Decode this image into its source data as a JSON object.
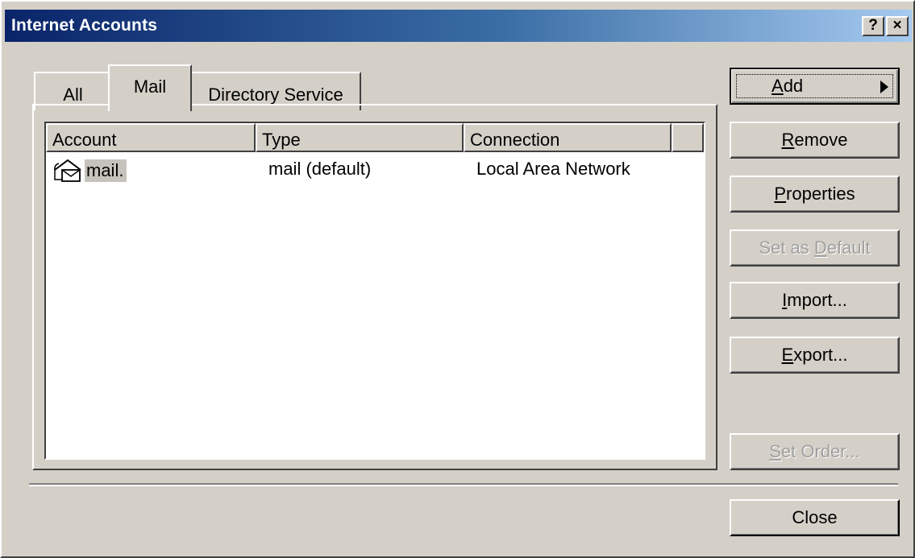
{
  "window": {
    "title": "Internet Accounts",
    "help_glyph": "?",
    "close_glyph": "×"
  },
  "tabs": [
    {
      "label": "All"
    },
    {
      "label": "Mail",
      "selected": true
    },
    {
      "label": "Directory Service"
    }
  ],
  "list": {
    "columns": [
      "Account",
      "Type",
      "Connection"
    ],
    "rows": [
      {
        "account": "mail.",
        "type": "mail (default)",
        "connection": "Local Area Network",
        "icon": "mail-account-icon"
      }
    ]
  },
  "buttons": {
    "add": {
      "label_underlined": "A",
      "label_rest": "dd",
      "enabled": true
    },
    "remove": {
      "label_underlined": "R",
      "label_rest": "emove",
      "enabled": true
    },
    "properties": {
      "label_underlined": "P",
      "label_rest": "roperties",
      "enabled": true
    },
    "set_default": {
      "label_prefix": "Set as ",
      "label_underlined": "D",
      "label_rest": "efault",
      "enabled": false
    },
    "import": {
      "label_underlined": "I",
      "label_rest": "mport...",
      "enabled": true
    },
    "export": {
      "label_underlined": "E",
      "label_rest": "xport...",
      "enabled": true
    },
    "set_order": {
      "label_underlined": "S",
      "label_rest": "et Order...",
      "enabled": false
    },
    "close": {
      "label": "Close",
      "enabled": true
    }
  },
  "colors": {
    "face": "#d4d0c8",
    "title_start": "#0a246a",
    "title_end": "#a6caf0"
  }
}
